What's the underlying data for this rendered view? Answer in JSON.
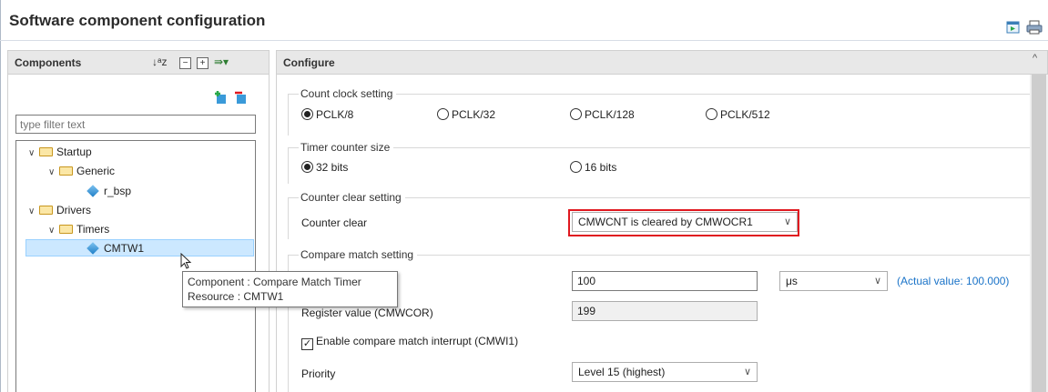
{
  "header": {
    "title": "Software component configuration",
    "icons": [
      "generate-code-icon",
      "print-icon"
    ]
  },
  "components_panel": {
    "title": "Components",
    "tools": [
      "sort-az-icon",
      "collapse-all-icon",
      "expand-all-icon",
      "view-menu-icon"
    ],
    "add_icon": "add-component-icon",
    "remove_icon": "remove-component-icon",
    "filter_placeholder": "type filter text",
    "tree": [
      {
        "label": "Startup",
        "level": 0,
        "type": "folder",
        "expanded": true
      },
      {
        "label": "Generic",
        "level": 1,
        "type": "folder",
        "expanded": true
      },
      {
        "label": "r_bsp",
        "level": 2,
        "type": "component"
      },
      {
        "label": "Drivers",
        "level": 0,
        "type": "folder",
        "expanded": true
      },
      {
        "label": "Timers",
        "level": 1,
        "type": "folder",
        "expanded": true
      },
      {
        "label": "CMTW1",
        "level": 2,
        "type": "component",
        "selected": true
      }
    ],
    "tooltip": {
      "line1": "Component : Compare Match Timer",
      "line2": "Resource : CMTW1"
    }
  },
  "configure": {
    "title": "Configure",
    "count_clock": {
      "label": "Count clock setting",
      "options": [
        "PCLK/8",
        "PCLK/32",
        "PCLK/128",
        "PCLK/512"
      ],
      "selected": "PCLK/8"
    },
    "counter_size": {
      "label": "Timer counter size",
      "options": [
        "32 bits",
        "16 bits"
      ],
      "selected": "32 bits"
    },
    "counter_clear": {
      "label": "Counter clear setting",
      "field_label": "Counter clear",
      "value": "CMWCNT is cleared by CMWOCR1"
    },
    "compare_match": {
      "label": "Compare match setting",
      "interval_value": "100",
      "unit": "μs",
      "actual_value": "(Actual value: 100.000)",
      "register_label": "Register value (CMWCOR)",
      "register_value": "199",
      "interrupt_label": "Enable compare match interrupt (CMWI1)",
      "interrupt_checked": true,
      "priority_label": "Priority",
      "priority_value": "Level 15 (highest)"
    }
  },
  "colors": {
    "highlight": "#e0181f",
    "selection": "#cce8ff",
    "link": "#1a73c8"
  }
}
